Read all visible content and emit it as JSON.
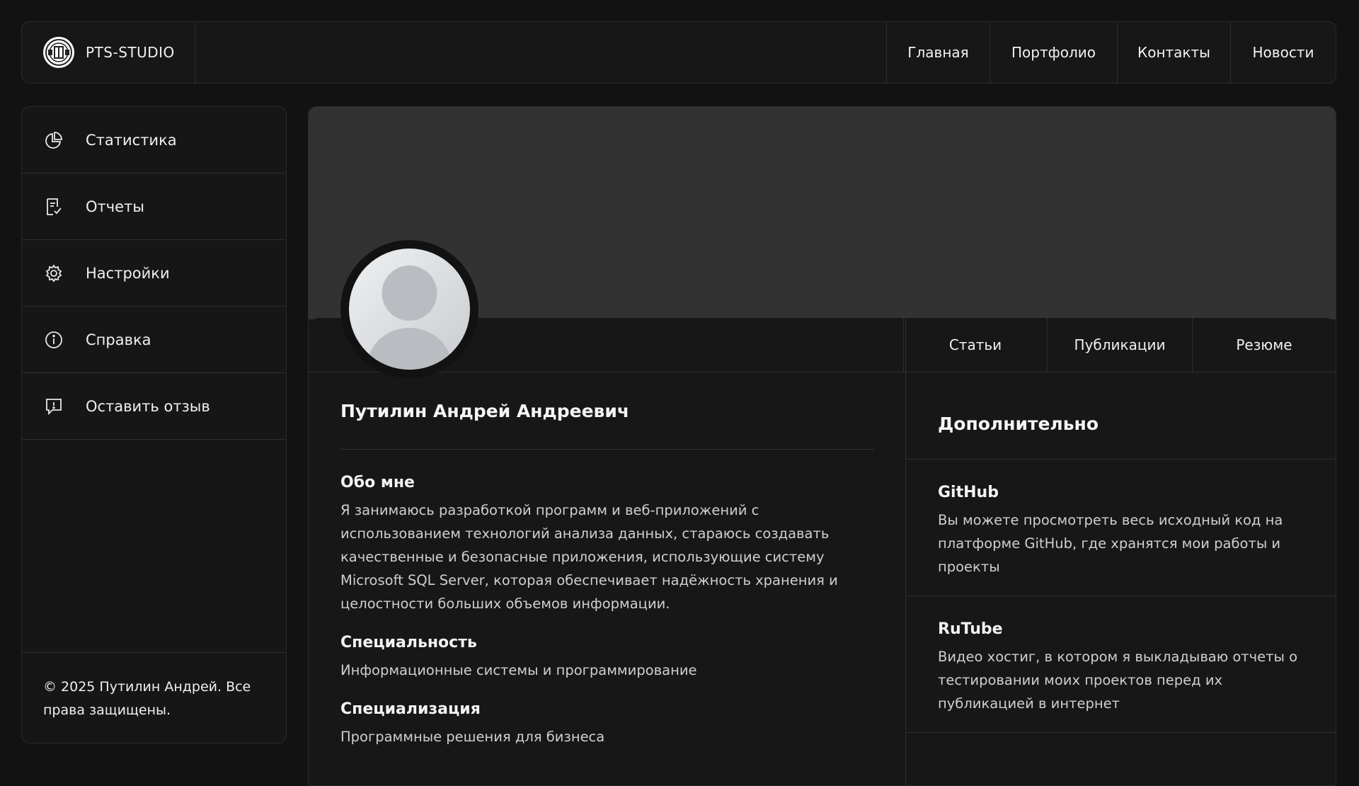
{
  "brand": {
    "name": "PTS-STUDIO",
    "logo_icon": "pts-logo-icon"
  },
  "topnav": [
    {
      "label": "Главная"
    },
    {
      "label": "Портфолио"
    },
    {
      "label": "Контакты"
    },
    {
      "label": "Новости"
    }
  ],
  "sidebar": {
    "items": [
      {
        "label": "Статистика",
        "icon": "pie-chart-icon"
      },
      {
        "label": "Отчеты",
        "icon": "report-check-icon"
      },
      {
        "label": "Настройки",
        "icon": "gear-icon"
      },
      {
        "label": "Справка",
        "icon": "info-icon"
      },
      {
        "label": "Оставить отзыв",
        "icon": "feedback-icon"
      }
    ],
    "footer": "© 2025 Путилин Андрей. Все права защищены."
  },
  "profile": {
    "tabs": [
      {
        "label": "Статьи"
      },
      {
        "label": "Публикации"
      },
      {
        "label": "Резюме"
      }
    ],
    "name": "Путилин Андрей Андреевич",
    "about_title": "Обо мне",
    "about_text": "Я занимаюсь разработкой программ и веб-приложений с использованием технологий анализа данных, стараюсь создавать качественные и безопасные приложения, использующие систему Microsoft SQL Server, которая обеспечивает надёжность хранения и целостности больших объемов информации.",
    "specialty_title": "Специальность",
    "specialty_text": "Информационные системы и программирование",
    "specialization_title": "Специализация",
    "specialization_text": "Программные решения для бизнеса"
  },
  "extra": {
    "title": "Дополнительно",
    "blocks": [
      {
        "title": "GitHub",
        "text": "Вы можете просмотреть весь исходный код на платформе GitHub, где хранятся мои работы и проекты"
      },
      {
        "title": "RuTube",
        "text": "Видео хостиг, в котором я выкладываю отчеты о тестировании моих проектов перед их публикацией в интернет"
      }
    ]
  },
  "colors": {
    "background": "#121212",
    "panel": "#171717",
    "cover": "#323232",
    "text": "#ececec"
  }
}
